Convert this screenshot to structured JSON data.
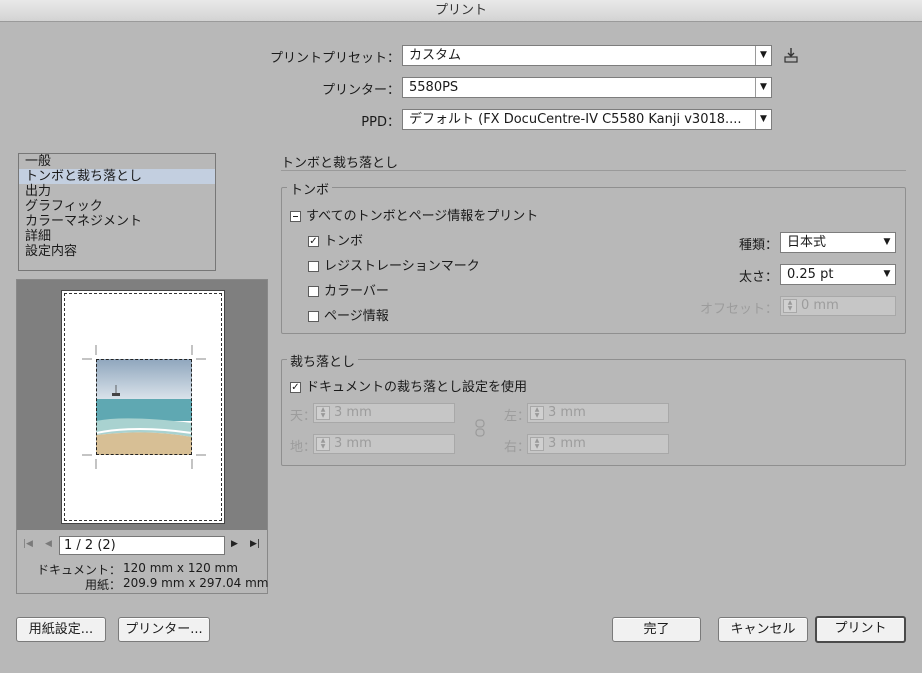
{
  "window": {
    "title": "プリント"
  },
  "header": {
    "preset_label": "プリントプリセット：",
    "preset_value": "カスタム",
    "printer_label": "プリンター：",
    "printer_value": "5580PS",
    "ppd_label": "PPD：",
    "ppd_value": "デフォルト (FX DocuCentre-IV C5580 Kanji v3018...."
  },
  "sidebar": {
    "items": [
      {
        "label": "一般"
      },
      {
        "label": "トンボと裁ち落とし"
      },
      {
        "label": "出力"
      },
      {
        "label": "グラフィック"
      },
      {
        "label": "カラーマネジメント"
      },
      {
        "label": "詳細"
      },
      {
        "label": "設定内容"
      }
    ],
    "selected_index": 1
  },
  "preview": {
    "page_value": "1 / 2 (2)",
    "document_label": "ドキュメント：",
    "document_size": "120 mm x 120 mm",
    "paper_label": "用紙：",
    "paper_size": "209.9 mm x 297.04 mm"
  },
  "section": {
    "title": "トンボと裁ち落とし"
  },
  "marks": {
    "group_title": "トンボ",
    "all_marks_label": "すべてのトンボとページ情報をプリント",
    "all_marks_state": "mixed",
    "items": [
      {
        "label": "トンボ",
        "checked": true
      },
      {
        "label": "レジストレーションマーク",
        "checked": false
      },
      {
        "label": "カラーバー",
        "checked": false
      },
      {
        "label": "ページ情報",
        "checked": false
      }
    ],
    "type_label": "種類：",
    "type_value": "日本式",
    "weight_label": "太さ：",
    "weight_value": "0.25 pt",
    "offset_label": "オフセット：",
    "offset_value": "0 mm"
  },
  "bleed": {
    "group_title": "裁ち落とし",
    "use_doc_label": "ドキュメントの裁ち落とし設定を使用",
    "use_doc_checked": true,
    "top_label": "天：",
    "top_value": "3 mm",
    "bottom_label": "地：",
    "bottom_value": "3 mm",
    "left_label": "左：",
    "left_value": "3 mm",
    "right_label": "右：",
    "right_value": "3 mm"
  },
  "footer": {
    "page_setup_label": "用紙設定...",
    "printer_label": "プリンター...",
    "done_label": "完了",
    "cancel_label": "キャンセル",
    "print_label": "プリント"
  }
}
